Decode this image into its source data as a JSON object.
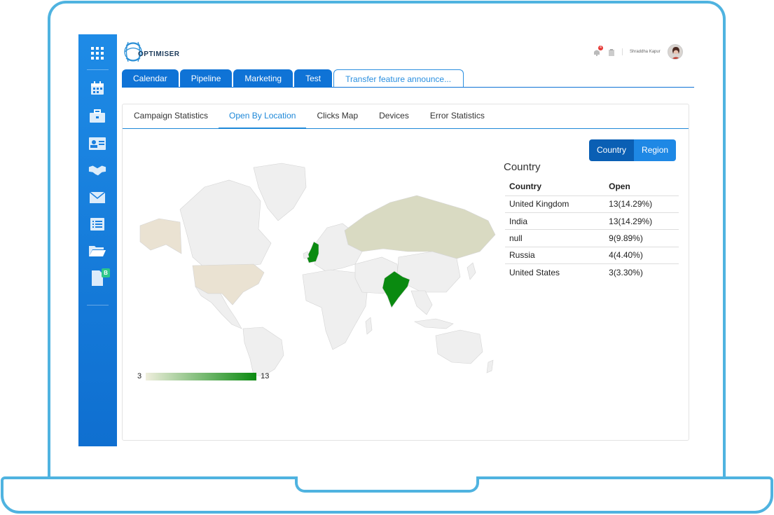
{
  "app": {
    "logo_text": "OPTIMISER"
  },
  "header": {
    "user_name": "Shraddha Kapur",
    "notification_count": "4"
  },
  "sidebar": {
    "items": [
      {
        "icon": "apps-grid-icon"
      },
      {
        "icon": "calendar-icon"
      },
      {
        "icon": "briefcase-icon"
      },
      {
        "icon": "contact-card-icon"
      },
      {
        "icon": "handshake-icon"
      },
      {
        "icon": "mail-icon"
      },
      {
        "icon": "list-icon"
      },
      {
        "icon": "folder-icon"
      },
      {
        "icon": "document-icon",
        "badge": "B"
      }
    ]
  },
  "main_tabs": [
    {
      "label": "Calendar"
    },
    {
      "label": "Pipeline"
    },
    {
      "label": "Marketing"
    },
    {
      "label": "Test"
    },
    {
      "label": "Transfer feature announce..."
    }
  ],
  "sub_tabs": [
    {
      "label": "Campaign Statistics"
    },
    {
      "label": "Open By Location"
    },
    {
      "label": "Clicks Map"
    },
    {
      "label": "Devices"
    },
    {
      "label": "Error Statistics"
    }
  ],
  "toggle": {
    "country": "Country",
    "region": "Region"
  },
  "legend": {
    "min": "3",
    "max": "13",
    "min_color": "#efeedd",
    "max_color": "#0a8a10"
  },
  "table": {
    "title": "Country",
    "headers": {
      "country": "Country",
      "open": "Open"
    },
    "rows": [
      {
        "country": "United Kingdom",
        "open": "13(14.29%)"
      },
      {
        "country": "India",
        "open": "13(14.29%)"
      },
      {
        "country": "null",
        "open": "9(9.89%)"
      },
      {
        "country": "Russia",
        "open": "4(4.40%)"
      },
      {
        "country": "United States",
        "open": "3(3.30%)"
      }
    ]
  },
  "colors": {
    "accent": "#0f73d6",
    "frame": "#4fb3e0",
    "map_base": "#efefef",
    "map_green": "#0a8a10"
  }
}
